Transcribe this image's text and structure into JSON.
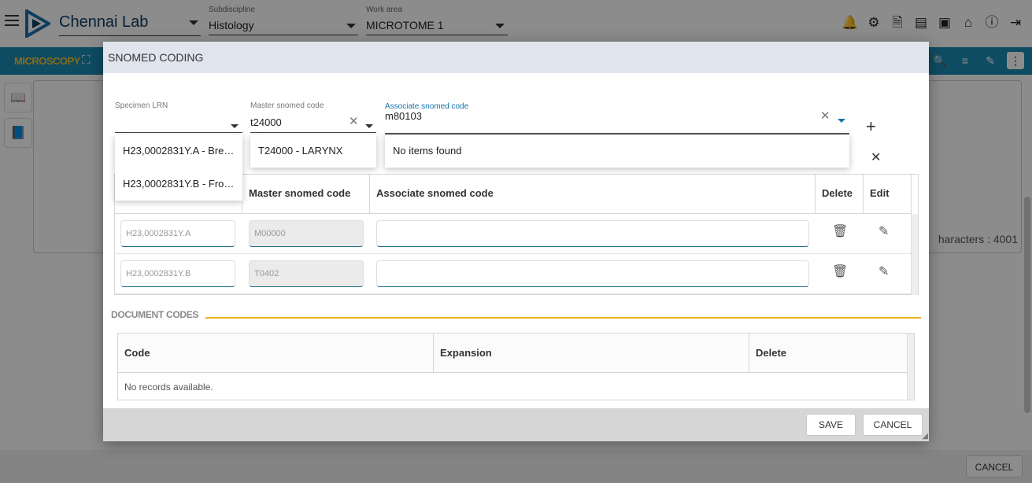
{
  "app": {
    "title": "Chennai Lab",
    "subdiscipline_label": "Subdiscipline",
    "subdiscipline_value": "Histology",
    "workarea_label": "Work area",
    "workarea_value": "MICROTOME 1",
    "toolbar_title": "MICROSCOPY",
    "characters_text": "haracters : 4001",
    "cancel_label": "CANCEL"
  },
  "modal": {
    "title": "SNOMED CODING",
    "fields": {
      "specimen_lrn_label": "Specimen LRN",
      "specimen_lrn_value": "",
      "master_code_label": "Master snomed code",
      "master_code_value": "t24000",
      "associate_code_label": "Associate snomed code",
      "associate_code_value": "m80103"
    },
    "specimen_options": [
      "H23,0002831Y.A - Bre…",
      "H23,0002831Y.B - Fro…"
    ],
    "master_options": [
      "T24000 - LARYNX"
    ],
    "associate_options_empty": "No items found",
    "codes_table": {
      "headers": [
        "Master snomed code",
        "Associate snomed code",
        "Delete",
        "Edit"
      ],
      "rows": [
        {
          "lrn": "H23,0002831Y.A",
          "master": "M00000",
          "associate": ""
        },
        {
          "lrn": "H23,0002831Y.B",
          "master": "T0402",
          "associate": ""
        }
      ]
    },
    "document_codes": {
      "title": "DOCUMENT CODES",
      "headers": [
        "Code",
        "Expansion",
        "Delete"
      ],
      "empty_text": "No records available."
    },
    "footer": {
      "save_label": "SAVE",
      "cancel_label": "CANCEL"
    }
  },
  "colors": {
    "accent": "#1a8ab3",
    "toolbar_title": "#f5c430",
    "section_line": "#e8b422",
    "header_bg": "#dfe4ed"
  }
}
